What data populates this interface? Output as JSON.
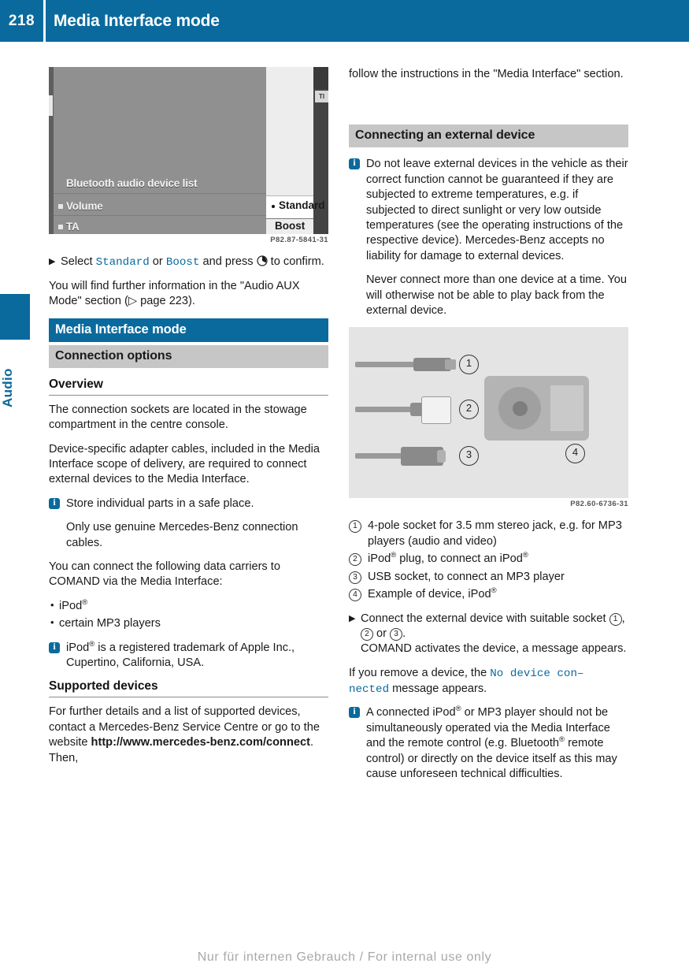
{
  "header": {
    "page_number": "218",
    "title": "Media Interface mode",
    "bg_color": "#0a6a9d"
  },
  "side_tab": {
    "label": "Audio",
    "color": "#0a6a9d"
  },
  "left_column": {
    "figure1": {
      "caption": "P82.87-5841-31",
      "screen_items": {
        "bluetooth_list": "Bluetooth audio device list",
        "volume": "Volume",
        "ta": "TA",
        "standard": "Standard",
        "boost": "Boost",
        "ti": "TI"
      }
    },
    "step_select": {
      "prefix": "Select ",
      "option1": "Standard",
      "joiner": " or ",
      "option2": "Boost",
      "suffix": " and press ",
      "tail": " to confirm."
    },
    "para_aux": "You will find further information in the \"Audio AUX Mode\" section (▷ page 223).",
    "banner_blue": "Media Interface mode",
    "banner_gray": "Connection options",
    "head_overview": "Overview",
    "para_sockets": "The connection sockets are located in the stowage compartment in the centre console.",
    "para_adapters": "Device-specific adapter cables, included in the Media Interface scope of delivery, are required to connect external devices to the Media Interface.",
    "info_store": "Store individual parts in a safe place.",
    "info_store_sub": "Only use genuine Mercedes-Benz connection cables.",
    "para_carriers": "You can connect the following data carriers to COMAND via the Media Interface:",
    "bullets": [
      "iPod",
      "certain MP3 players"
    ],
    "bullet_reg_first": "®",
    "info_trademark_pre": "iPod",
    "info_trademark_post": " is a registered trademark of Apple Inc., Cupertino, California, USA.",
    "head_supported": "Supported devices",
    "para_supported_1": "For further details and a list of supported devices, contact a Mercedes-Benz Service Centre or go to the website ",
    "para_supported_url": "http://www.mercedes-benz.com/connect",
    "para_supported_2": ". Then,"
  },
  "right_column": {
    "para_follow": "follow the instructions in the \"Media Interface\" section.",
    "banner_gray": "Connecting an external device",
    "info_external": "Do not leave external devices in the vehicle as their correct function cannot be guaranteed if they are subjected to extreme temperatures, e.g. if subjected to direct sunlight or very low outside temperatures (see the operating instructions of the respective device). Mercedes-Benz accepts no liability for damage to external devices.",
    "info_external_sub": "Never connect more than one device at a time. You will otherwise not be able to play back from the external device.",
    "figure2": {
      "caption": "P82.60-6736-31",
      "callouts": [
        "1",
        "2",
        "3",
        "4"
      ]
    },
    "legend": [
      {
        "num": "1",
        "text": "4-pole socket for 3.5 mm stereo jack, e.g. for MP3 players (audio and video)",
        "reg": false
      },
      {
        "num": "2",
        "text_pre": "iPod",
        "text_mid": " plug, to connect an iPod",
        "reg": true
      },
      {
        "num": "3",
        "text": "USB socket, to connect an MP3 player",
        "reg": false
      },
      {
        "num": "4",
        "text_pre": "Example of device, iPod",
        "reg": true
      }
    ],
    "step_connect_1": "Connect the external device with suitable socket ",
    "step_connect_2": "COMAND activates the device, a message appears.",
    "para_remove_pre": "If you remove a device, the ",
    "para_remove_msg": "No device con– nected",
    "para_remove_msg_line1": "No device con–",
    "para_remove_msg_line2": "nected",
    "para_remove_post": " message appears.",
    "info_connected_pre": "A connected iPod",
    "info_connected_mid": " or MP3 player should not be simultaneously operated via the Media Interface and the remote control (e.g. Bluetooth",
    "info_connected_post": " remote control) or directly on the device itself as this may cause unforeseen technical difficulties."
  },
  "footer": {
    "watermark": "Nur für internen Gebrauch / For internal use only"
  }
}
